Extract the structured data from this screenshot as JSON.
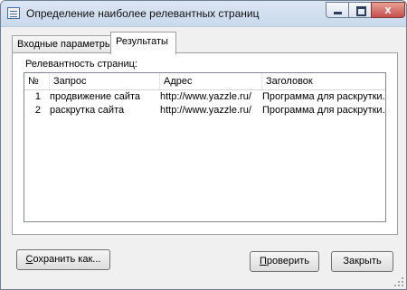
{
  "window": {
    "title": "Определение наиболее релевантных страниц",
    "close_glyph": "x"
  },
  "tabs": [
    {
      "label": "Входные параметры",
      "active": false
    },
    {
      "label": "Результаты",
      "active": true
    }
  ],
  "panel": {
    "label": "Релевантность страниц:"
  },
  "table": {
    "columns": [
      "№",
      "Запрос",
      "Адрес",
      "Заголовок"
    ],
    "rows": [
      [
        "1",
        "продвижение сайта",
        "http://www.yazzle.ru/",
        "Программа для раскрутки..."
      ],
      [
        "2",
        "раскрутка сайта",
        "http://www.yazzle.ru/",
        "Программа для раскрутки..."
      ]
    ]
  },
  "buttons": {
    "save_label_rest": "охранить как...",
    "save_label_mnemonic": "С",
    "check_label_mnemonic": "П",
    "check_label_rest": "роверить",
    "close_label": "Закрыть"
  },
  "icons": {
    "app": "window-app-icon",
    "minimize": "minimize-icon",
    "maximize": "maximize-icon",
    "close": "close-icon"
  }
}
